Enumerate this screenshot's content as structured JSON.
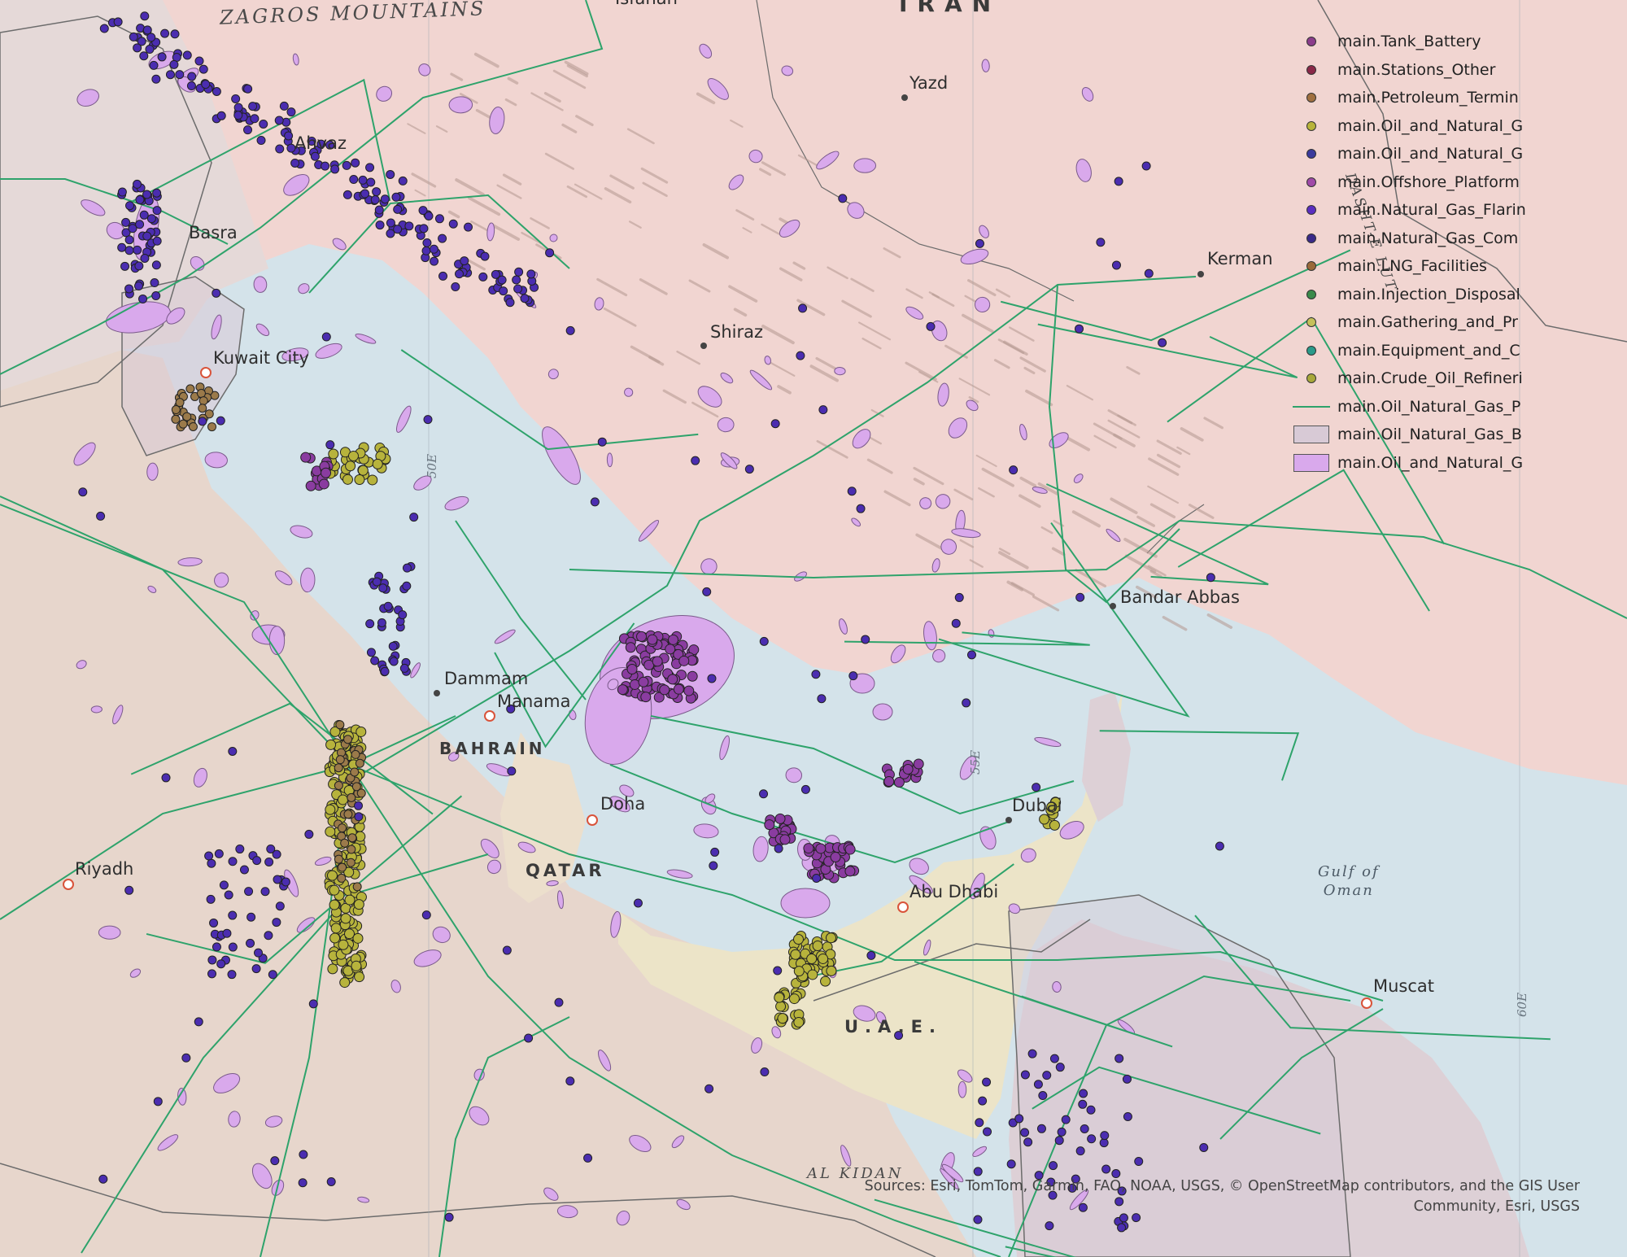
{
  "colors": {
    "water": "#d4e3ea",
    "land_iran": "#f1d5d1",
    "land_arabia": "#e7d6cc",
    "land_iraq": "#e5d9d8",
    "land_uae": "#ece4c8",
    "land_oman": "#ddd0d6",
    "land_qatar": "#ecdfcc",
    "pipeline": "#2ea36b",
    "field_fill": "#d9a9ec",
    "field_stroke": "#7a5a8a",
    "basin_fill": "#d8cad6",
    "dot_flaring": "#4b2db0",
    "dot_platform": "#8a3ca0",
    "dot_refinery": "#b7b33c",
    "dot_lng": "#9b7a4a"
  },
  "map_labels": {
    "cities": [
      {
        "id": "yazd",
        "text": "Yazd"
      },
      {
        "id": "ahvaz",
        "text": "Ahvaz"
      },
      {
        "id": "basra",
        "text": "Basra"
      },
      {
        "id": "kerman",
        "text": "Kerman"
      },
      {
        "id": "shiraz",
        "text": "Shiraz"
      },
      {
        "id": "kuwait",
        "text": "Kuwait City"
      },
      {
        "id": "bandar",
        "text": "Bandar Abbas"
      },
      {
        "id": "dammam",
        "text": "Dammam"
      },
      {
        "id": "manama",
        "text": "Manama"
      },
      {
        "id": "doha",
        "text": "Doha"
      },
      {
        "id": "dubai",
        "text": "Dubai"
      },
      {
        "id": "abudhabi",
        "text": "Abu Dhabi"
      },
      {
        "id": "riyadh",
        "text": "Riyadh"
      },
      {
        "id": "muscat",
        "text": "Muscat"
      },
      {
        "id": "isfahan",
        "text": "Isfahan"
      }
    ],
    "countries": [
      {
        "id": "iran",
        "text": "IRAN"
      },
      {
        "id": "bahrain",
        "text": "BAHRAIN"
      },
      {
        "id": "qatar",
        "text": "QATAR"
      },
      {
        "id": "uae",
        "text": "U.A.E."
      }
    ],
    "regions": [
      {
        "id": "zagros",
        "text": "ZAGROS MOUNTAINS"
      },
      {
        "id": "alkidan",
        "text": "AL KIDAN"
      },
      {
        "id": "dashtelut",
        "text": "DASHT-E LUT"
      }
    ],
    "water": {
      "gulf_of_oman": "Gulf of\nOman"
    },
    "graticule": [
      {
        "id": "g50",
        "text": "50E"
      },
      {
        "id": "g55",
        "text": "55E"
      },
      {
        "id": "g60",
        "text": "60E"
      }
    ]
  },
  "legend": {
    "items": [
      {
        "label": "main.Tank_Battery",
        "symbol": "dot",
        "color": "#8b3d8b"
      },
      {
        "label": "main.Stations_Other",
        "symbol": "dot",
        "color": "#8a2848"
      },
      {
        "label": "main.Petroleum_Termin",
        "symbol": "dot",
        "color": "#a07040"
      },
      {
        "label": "main.Oil_and_Natural_G",
        "symbol": "dot",
        "color": "#b8b43a"
      },
      {
        "label": "main.Oil_and_Natural_G",
        "symbol": "dot",
        "color": "#3b3a9c"
      },
      {
        "label": "main.Offshore_Platform",
        "symbol": "dot",
        "color": "#a04aa8"
      },
      {
        "label": "main.Natural_Gas_Flarin",
        "symbol": "dot",
        "color": "#5b2ec0"
      },
      {
        "label": "main.Natural_Gas_Com",
        "symbol": "dot",
        "color": "#3a2a8a"
      },
      {
        "label": "main.LNG_Facilities",
        "symbol": "dot",
        "color": "#9a6a3a"
      },
      {
        "label": "main.Injection_Disposal",
        "symbol": "dot",
        "color": "#3a8a4a"
      },
      {
        "label": "main.Gathering_and_Pr",
        "symbol": "dot",
        "color": "#c4c05a"
      },
      {
        "label": "main.Equipment_and_C",
        "symbol": "dot",
        "color": "#2a9a8a"
      },
      {
        "label": "main.Crude_Oil_Refineri",
        "symbol": "dot",
        "color": "#a8a83a"
      },
      {
        "label": "main.Oil_Natural_Gas_P",
        "symbol": "line",
        "color": "#2ea36b"
      },
      {
        "label": "main.Oil_Natural_Gas_B",
        "symbol": "poly",
        "color": "#d8cad6"
      },
      {
        "label": "main.Oil_and_Natural_G",
        "symbol": "poly",
        "color": "#d9a9ec"
      }
    ]
  },
  "attribution": {
    "line1": "Sources: Esri, TomTom, Garmin, FAO, NOAA, USGS, © OpenStreetMap contributors, and the GIS User",
    "line2": "Community, Esri, USGS"
  }
}
